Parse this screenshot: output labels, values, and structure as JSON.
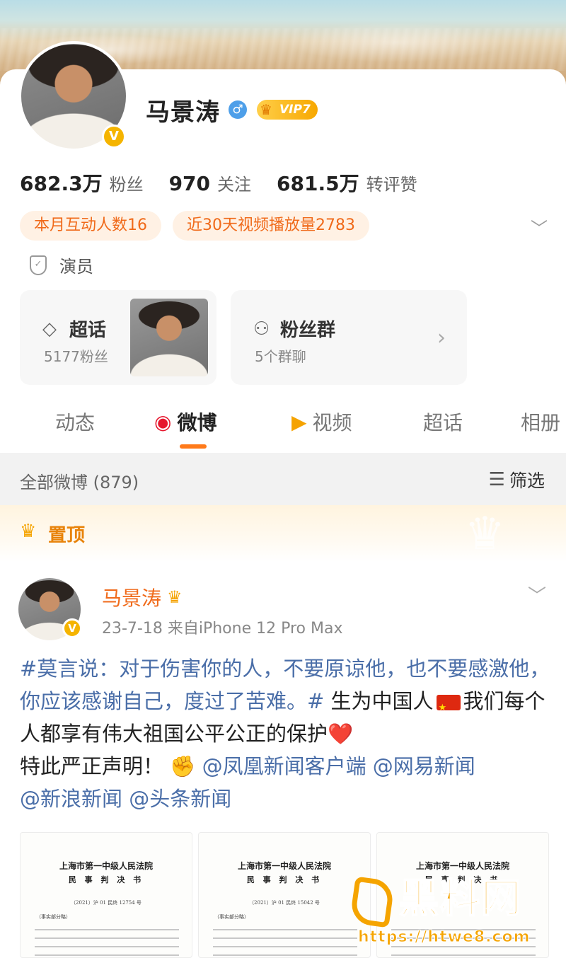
{
  "profile": {
    "name": "马景涛",
    "gender_symbol": "♂",
    "vip_label": "VIP7",
    "verified_symbol": "V",
    "stats": [
      {
        "num": "682.3万",
        "label": "粉丝"
      },
      {
        "num": "970",
        "label": "关注"
      },
      {
        "num": "681.5万",
        "label": "转评赞"
      }
    ],
    "tags": [
      "本月互动人数16",
      "近30天视频播放量2783"
    ],
    "role": "演员",
    "supertopic": {
      "title": "超话",
      "sub": "5177粉丝"
    },
    "fan_group": {
      "title": "粉丝群",
      "sub": "5个群聊"
    }
  },
  "tabs": [
    {
      "label": "动态",
      "active": false
    },
    {
      "label": "微博",
      "active": true,
      "icon": "weibo-icon"
    },
    {
      "label": "视频",
      "active": false,
      "icon": "video-icon"
    },
    {
      "label": "超话",
      "active": false
    },
    {
      "label": "相册",
      "active": false
    }
  ],
  "filterbar": {
    "count_label": "全部微博 (879)",
    "filter_label": "筛选"
  },
  "pinned": {
    "label": "置顶"
  },
  "post": {
    "author": "马景涛",
    "meta": "23-7-18  来自iPhone 12 Pro Max",
    "topic": "#莫言说：对于伤害你的人，不要原谅他，也不要感激他，你应该感谢自己，度过了苦难。#",
    "text_1": "  生为中国人",
    "text_2": "我们每个人都享有伟大祖国公平公正的保护",
    "heart": "❤️",
    "text_3": "特此严正声明！",
    "fist": "✊",
    "mentions": [
      "@凤凰新闻客户端",
      "@网易新闻",
      "@新浪新闻",
      "@头条新闻"
    ]
  },
  "images": [
    {
      "h1": "上海市第一中级人民法院",
      "h2": "民 事 判 决 书",
      "no": "（2021）沪 01 民终 12754 号",
      "sec": "（事实部分略）"
    },
    {
      "h1": "上海市第一中级人民法院",
      "h2": "民 事 判 决 书",
      "no": "（2021）沪 01 民终 15042 号",
      "sec": "（事实部分略）"
    },
    {
      "h1": "上海市第一中级人民法院",
      "h2": "民 事 判 决 书",
      "no": "",
      "sec": ""
    }
  ],
  "watermark": {
    "brand": "黑料网",
    "url": "https://htwe8.com"
  },
  "colors": {
    "accent": "#ff7a1a",
    "link": "#4a6ea8",
    "vip": "#f7a800",
    "verified": "#f5b400"
  }
}
